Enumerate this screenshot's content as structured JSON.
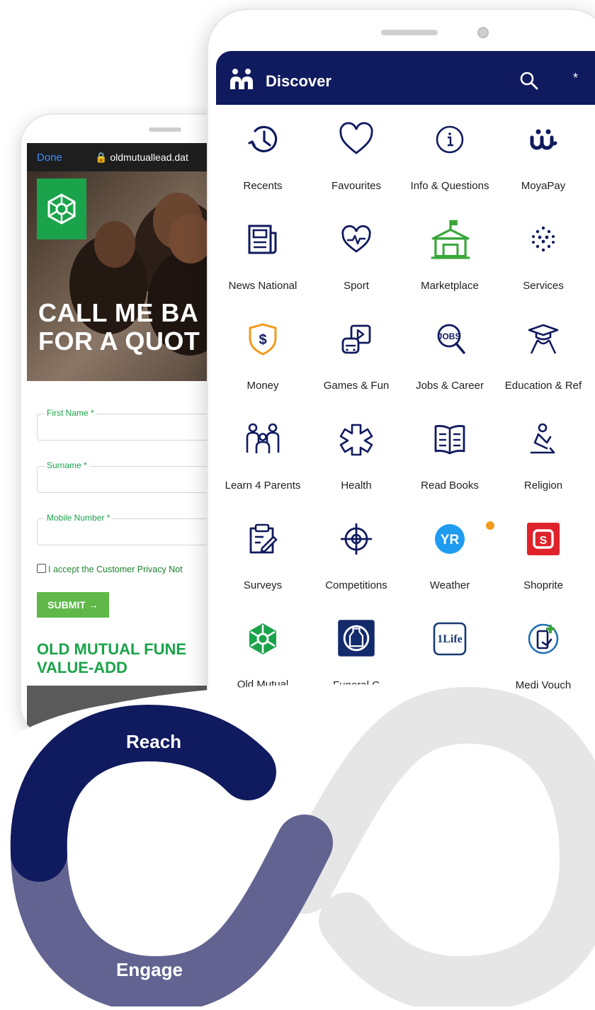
{
  "back_phone": {
    "browser": {
      "done_label": "Done",
      "url": "🔒 oldmutuallead.dat"
    },
    "hero_title_line1": "CALL ME BA",
    "hero_title_line2": "FOR A QUOT",
    "form": {
      "first_name_label": "First Name *",
      "surname_label": "Surname *",
      "mobile_label": "Mobile Number *",
      "consent_prefix": "I accept the ",
      "consent_link": "Customer Privacy Not",
      "submit_label": "SUBMIT →"
    },
    "section_title_line1": "OLD MUTUAL FUNE",
    "section_title_line2": "VALUE-ADD"
  },
  "app": {
    "title": "Discover",
    "more_label": "*",
    "colors": {
      "header": "#101a5e",
      "icon": "#101a5e",
      "accent_green": "#3aa63a",
      "accent_orange": "#f39a1c"
    },
    "tiles": [
      {
        "label": "Recents",
        "icon": "clock-history-icon"
      },
      {
        "label": "Favourites",
        "icon": "heart-icon"
      },
      {
        "label": "Info & Questions",
        "icon": "info-icon"
      },
      {
        "label": "MoyaPay",
        "icon": "moyapay-icon"
      },
      {
        "label": "News National",
        "icon": "newspaper-icon"
      },
      {
        "label": "Sport",
        "icon": "heartbeat-icon"
      },
      {
        "label": "Marketplace",
        "icon": "market-building-icon"
      },
      {
        "label": "Services",
        "icon": "dots-cluster-icon"
      },
      {
        "label": "Money",
        "icon": "money-shield-icon"
      },
      {
        "label": "Games & Fun",
        "icon": "game-controller-icon"
      },
      {
        "label": "Jobs & Career",
        "icon": "jobs-search-icon"
      },
      {
        "label": "Education & Ref",
        "icon": "graduation-icon"
      },
      {
        "label": "Learn 4 Parents",
        "icon": "family-icon"
      },
      {
        "label": "Health",
        "icon": "medical-cross-icon"
      },
      {
        "label": "Read Books",
        "icon": "open-book-icon"
      },
      {
        "label": "Religion",
        "icon": "praying-icon"
      },
      {
        "label": "Surveys",
        "icon": "clipboard-edit-icon"
      },
      {
        "label": "Competitions",
        "icon": "target-icon"
      },
      {
        "label": "Weather",
        "icon": "weather-yr-icon"
      },
      {
        "label": "Shoprite",
        "icon": "shoprite-icon"
      },
      {
        "label": "Old Mutual\nFuneral",
        "icon": "old-mutual-icon"
      },
      {
        "label": "Funeral C",
        "icon": "funeral-cover-icon"
      },
      {
        "label": "",
        "icon": "1life-icon",
        "logo_text": "1Life"
      },
      {
        "label": "Medi Vouch",
        "icon": "medi-voucher-icon"
      }
    ],
    "weather_logo_text": "YR"
  },
  "infinity": {
    "reach_label": "Reach",
    "engage_label": "Engage",
    "colors": {
      "reach": "#101a5e",
      "engage": "#636391",
      "loop": "#e6e6e6"
    }
  }
}
